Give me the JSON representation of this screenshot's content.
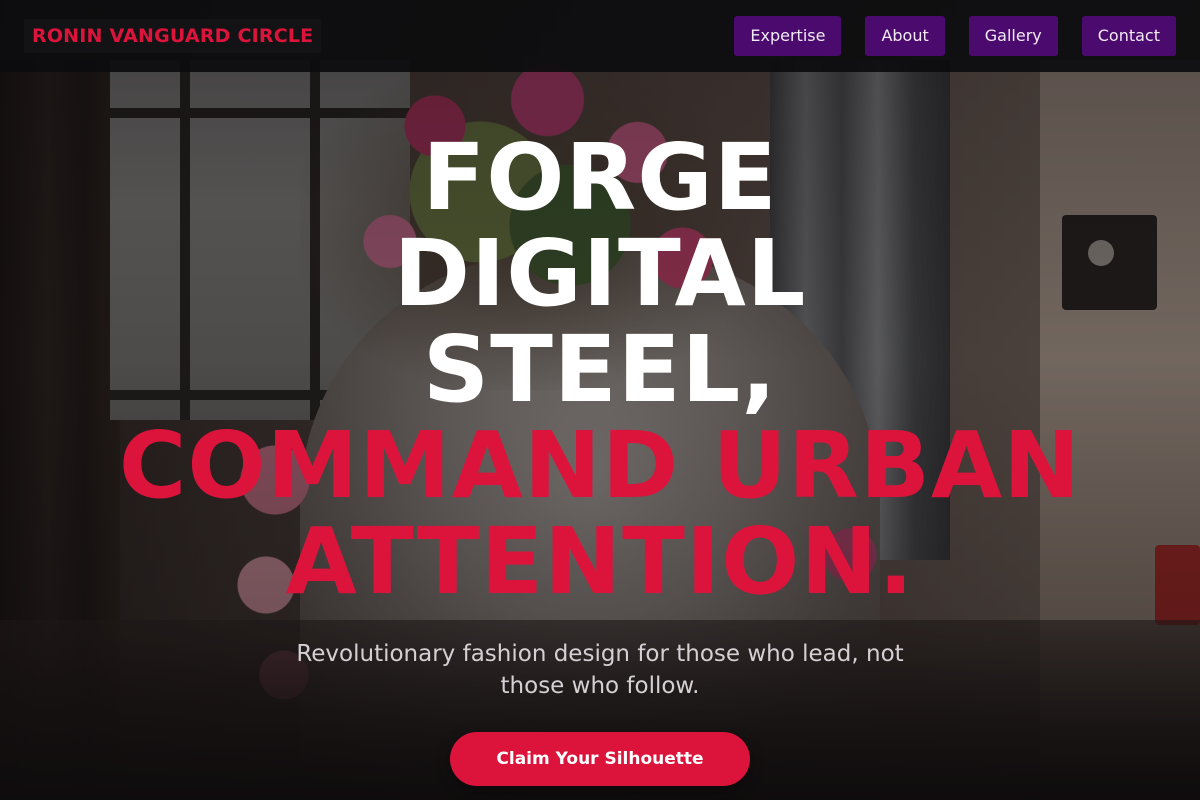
{
  "brand": {
    "name": "RONIN VANGUARD CIRCLE",
    "accent_color": "#dc143c",
    "nav_color": "#4b0a6e"
  },
  "nav": {
    "items": [
      {
        "label": "Expertise"
      },
      {
        "label": "About"
      },
      {
        "label": "Gallery"
      },
      {
        "label": "Contact"
      }
    ]
  },
  "hero": {
    "headline_line1": "FORGE DIGITAL STEEL,",
    "headline_line2": "COMMAND URBAN ATTENTION.",
    "subtitle": "Revolutionary fashion design for those who lead, not those who follow.",
    "cta_label": "Claim Your Silhouette"
  }
}
